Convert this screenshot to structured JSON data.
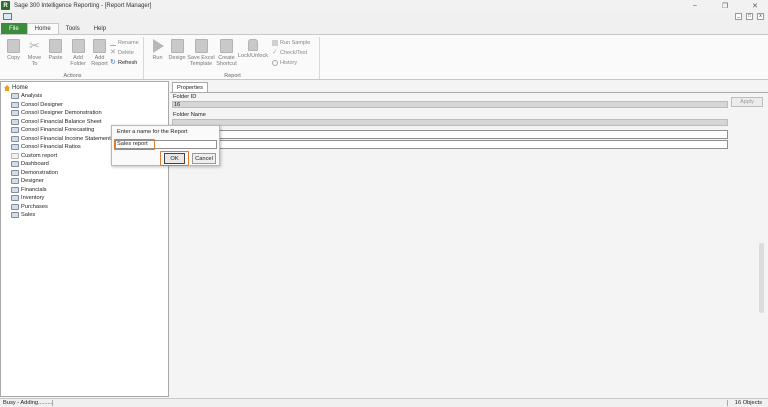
{
  "window": {
    "title": "Sage 300 Intelligence Reporting - [Report Manager]",
    "app_icon_letter": "R"
  },
  "ribbon_tabs": [
    {
      "label": "File"
    },
    {
      "label": "Home"
    },
    {
      "label": "Tools"
    },
    {
      "label": "Help"
    }
  ],
  "actions_group": {
    "label": "Actions",
    "buttons": [
      "Copy",
      "Move To",
      "Paste",
      "Add Folder",
      "Add Report"
    ],
    "small": [
      "Rename",
      "Delete",
      "Refresh"
    ]
  },
  "report_group": {
    "label": "Report",
    "buttons": [
      "Run",
      "Design",
      "Save Excel Template",
      "Create Shortcut",
      "Lock/Unlock"
    ],
    "small": [
      "Run Sample",
      "Check/Test",
      "History"
    ]
  },
  "tree": {
    "root": "Home",
    "items": [
      "Analysis",
      "Consol Designer",
      "Consol Designer Demonstration",
      "Consol Financial Balance Sheet",
      "Consol Financial Forecasting",
      "Consol Financial Income Statement",
      "Consol Financial Ratios",
      "Custom report",
      "Dashboard",
      "Demonstration",
      "Designer",
      "Financials",
      "Inventory",
      "Purchases",
      "Sales"
    ]
  },
  "properties": {
    "tab": "Properties",
    "folder_id_label": "Folder ID",
    "folder_id_value": "16",
    "folder_name_label": "Folder Name",
    "apply_label": "Apply"
  },
  "dialog": {
    "prompt": "Enter a name for the Report",
    "input_value": "Sales report",
    "ok_label": "OK",
    "cancel_label": "Cancel"
  },
  "status": {
    "left": "Busy - Adding.........",
    "right": "16 Objects"
  },
  "colors": {
    "file_tab": "#3b8d3b",
    "highlight": "#e07a2e"
  }
}
